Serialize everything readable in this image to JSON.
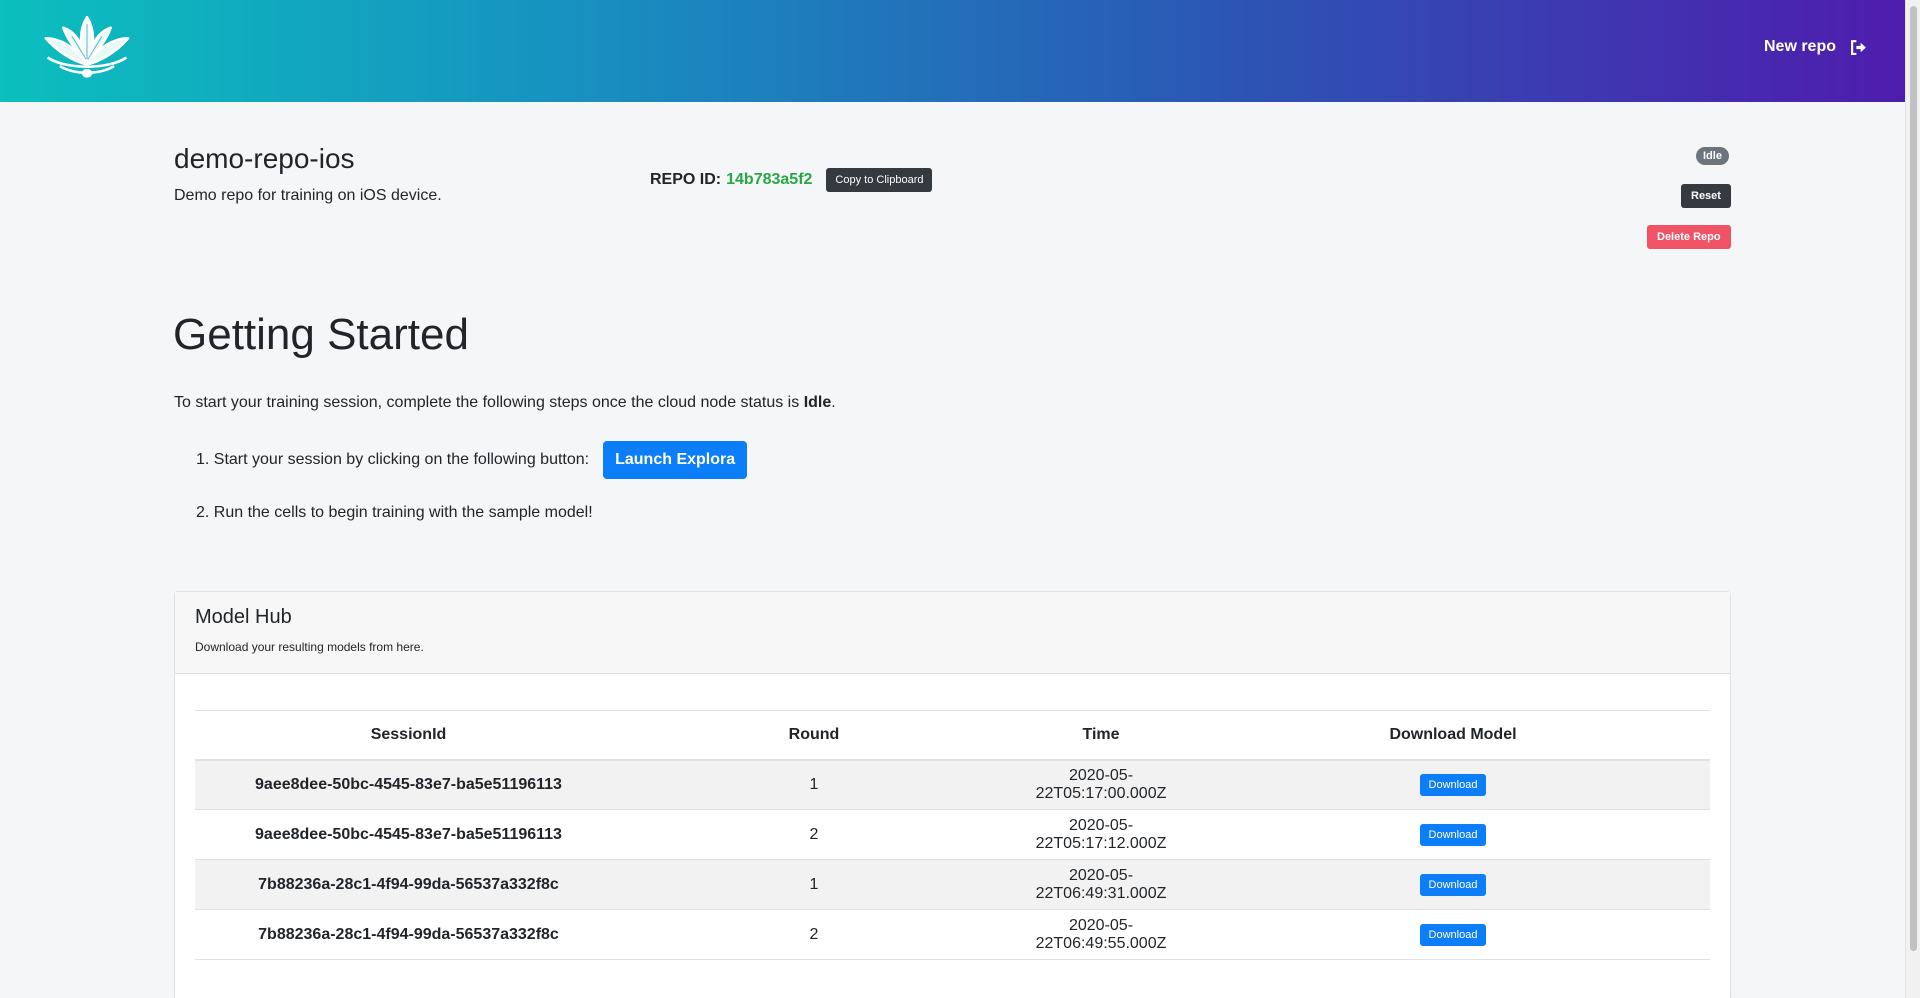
{
  "header": {
    "new_repo_label": "New repo",
    "logo_icon": "lotus-icon",
    "logout_icon": "logout-icon",
    "gradient": [
      "#0bbfbe",
      "#1791c0",
      "#2c55b5",
      "#4f1cad"
    ]
  },
  "repo": {
    "name": "demo-repo-ios",
    "description": "Demo repo for training on iOS device.",
    "id_label": "REPO ID:",
    "id_value": "14b783a5f2",
    "copy_label": "Copy to Clipboard",
    "status": "Idle",
    "reset_label": "Reset",
    "delete_label": "Delete Repo"
  },
  "getting_started": {
    "title": "Getting Started",
    "intro_before": "To start your training session, complete the following steps once the cloud node status is ",
    "intro_bold": "Idle",
    "intro_after": ".",
    "step1": "1. Start your session by clicking on the following button:",
    "launch_label": "Launch Explora",
    "step2": "2. Run the cells to begin training with the sample model!"
  },
  "model_hub": {
    "title": "Model Hub",
    "subtitle": "Download your resulting models from here.",
    "columns": [
      "SessionId",
      "Round",
      "Time",
      "Download Model"
    ],
    "rows": [
      {
        "session": "9aee8dee-50bc-4545-83e7-ba5e51196113",
        "round": "1",
        "time": "2020-05-22T05:17:00.000Z",
        "action": "Download"
      },
      {
        "session": "9aee8dee-50bc-4545-83e7-ba5e51196113",
        "round": "2",
        "time": "2020-05-22T05:17:12.000Z",
        "action": "Download"
      },
      {
        "session": "7b88236a-28c1-4f94-99da-56537a332f8c",
        "round": "1",
        "time": "2020-05-22T06:49:31.000Z",
        "action": "Download"
      },
      {
        "session": "7b88236a-28c1-4f94-99da-56537a332f8c",
        "round": "2",
        "time": "2020-05-22T06:49:55.000Z",
        "action": "Download"
      }
    ]
  },
  "colors": {
    "primary": "#0d7ef9",
    "danger": "#f05366",
    "dark": "#343a40",
    "success": "#28a745",
    "badge": "#6c757d"
  }
}
